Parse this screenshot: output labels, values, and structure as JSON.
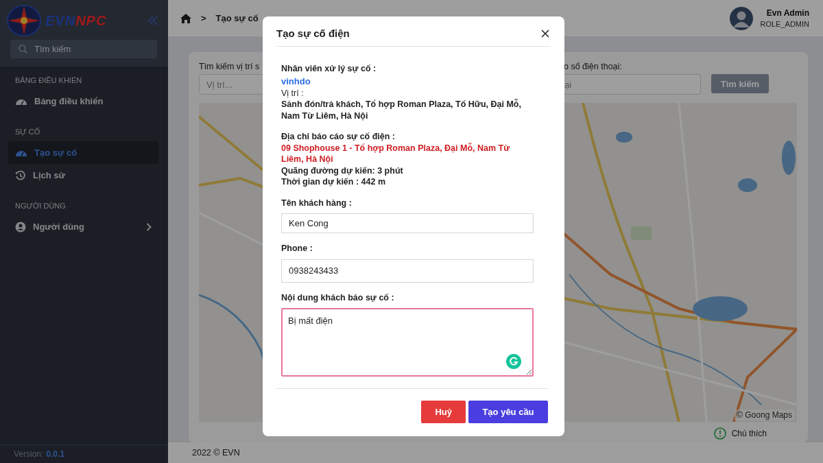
{
  "sidebar": {
    "logo": {
      "part_1": "EVN",
      "part_2": "NPC"
    },
    "search": {
      "placeholder": "Tìm kiếm"
    },
    "groups": [
      {
        "title": "BẢNG ĐIỀU KHIỂN",
        "items": [
          {
            "label": "Bảng điều khiển",
            "selected": false,
            "expandable": false
          }
        ]
      },
      {
        "title": "SỰ CỐ",
        "items": [
          {
            "label": "Tạo sự cố",
            "selected": true,
            "expandable": false
          },
          {
            "label": "Lịch sử",
            "selected": false,
            "expandable": false
          }
        ]
      },
      {
        "title": "NGƯỜI DÙNG",
        "items": [
          {
            "label": "Người dùng",
            "selected": false,
            "expandable": true
          }
        ]
      }
    ],
    "version_label": "Version:",
    "version": "0.0.1"
  },
  "header": {
    "breadcrumb": [
      "Tạo sự cố"
    ],
    "breadcrumb_separator": ">",
    "user": {
      "name": "Evn Admin",
      "role": "ROLE_ADMIN"
    }
  },
  "search_panel": {
    "location_label": "Tìm kiếm vị trí s",
    "location_placeholder": "Vị trí...",
    "phone_label": "o số điện thoại:",
    "phone_placeholder": "ại",
    "search_button": "Tìm kiếm"
  },
  "map": {
    "attribution": "© Goong Maps",
    "legend": "Chú thích"
  },
  "footer": "2022 © EVN",
  "modal": {
    "title": "Tạo sự cố điện",
    "staff_label": "Nhân viên xử lý sự cố :",
    "staff_name": "vinhdo",
    "location_label": "Vị trí :",
    "location": "Sảnh đón/trả khách, Tổ hợp Roman Plaza, Tố Hữu, Đại Mỗ, Nam Từ Liêm, Hà Nội",
    "report_address_label": "Địa chỉ báo cáo sự cố điện :",
    "report_address": "09 Shophouse 1 - Tổ hợp Roman Plaza, Đại Mỗ, Nam Từ Liêm, Hà Nội",
    "distance": "Quãng đường dự kiến: 3 phút",
    "duration": "Thời gian dự kiến : 442 m",
    "fields": [
      {
        "kind": "input",
        "label": "Tên khách hàng :",
        "value": "Ken Cong"
      },
      {
        "kind": "input",
        "label": "Phone :",
        "value": "0938243433"
      },
      {
        "kind": "textarea",
        "label": "Nội dung khách báo sự cố :",
        "value": "Bị mất điện"
      }
    ],
    "buttons": [
      {
        "kind": "cancel",
        "label": "Huỷ"
      },
      {
        "kind": "primary",
        "label": "Tạo yêu cầu"
      }
    ]
  }
}
